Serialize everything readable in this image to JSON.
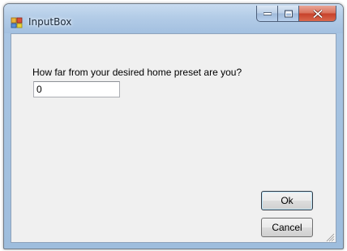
{
  "window": {
    "title": "InputBox",
    "icon": "app-icon",
    "caption_buttons": [
      "minimize-icon",
      "maximize-icon",
      "close-icon"
    ]
  },
  "dialog": {
    "prompt": "How far from your desired home preset are you?",
    "input_value": "0",
    "ok_label": "Ok",
    "cancel_label": "Cancel"
  },
  "colors": {
    "titlebar": "#b3cce7",
    "client_background": "#f0f0f0",
    "close_button": "#c6402a"
  }
}
